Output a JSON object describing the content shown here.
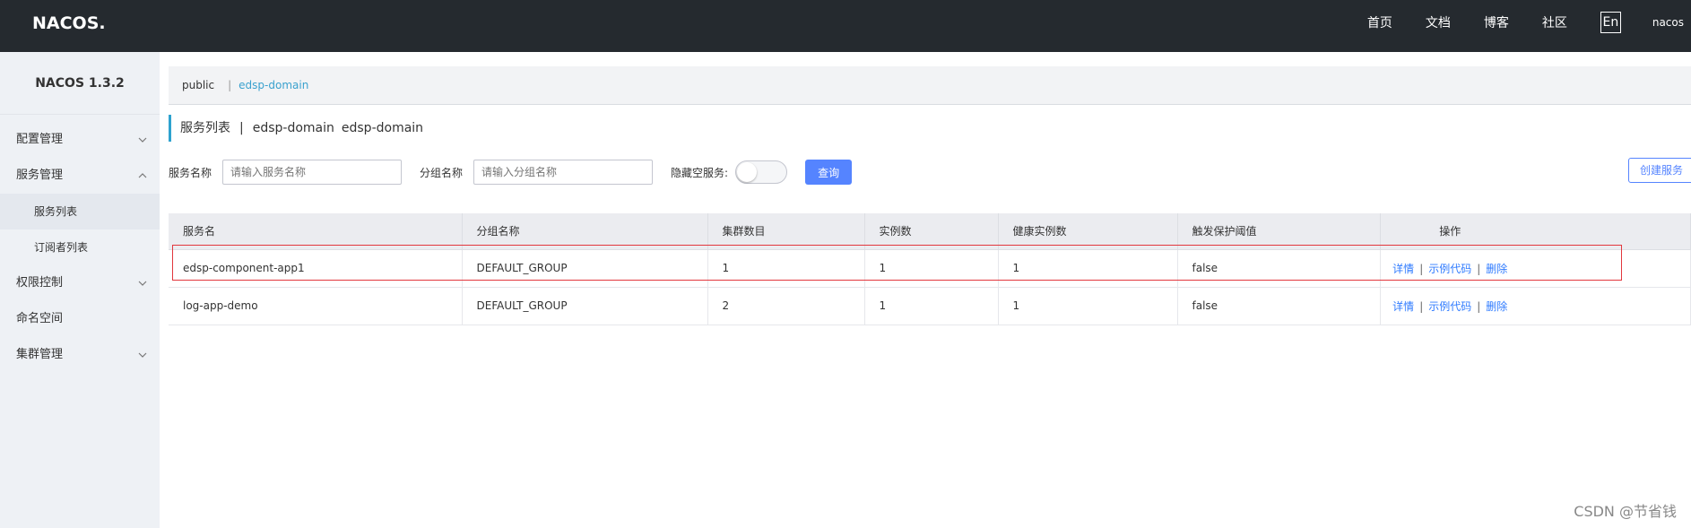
{
  "header": {
    "logo_text": "NACOS.",
    "nav": [
      "首页",
      "文档",
      "博客",
      "社区"
    ],
    "lang": "En",
    "user": "nacos"
  },
  "sidebar": {
    "title": "NACOS 1.3.2",
    "menu": {
      "config": "配置管理",
      "service": "服务管理",
      "service_list": "服务列表",
      "subscriber_list": "订阅者列表",
      "auth": "权限控制",
      "namespace": "命名空间",
      "cluster": "集群管理"
    }
  },
  "namespace_bar": {
    "items": [
      "public",
      "edsp-domain"
    ],
    "separator": "|"
  },
  "page_title": {
    "label": "服务列表",
    "separator": "|",
    "ns_name": "edsp-domain",
    "ns_id": "edsp-domain"
  },
  "filter": {
    "service_label": "服务名称",
    "service_placeholder": "请输入服务名称",
    "group_label": "分组名称",
    "group_placeholder": "请输入分组名称",
    "hide_empty_label": "隐藏空服务:",
    "query_label": "查询",
    "create_label": "创建服务"
  },
  "table": {
    "headers": [
      "服务名",
      "分组名称",
      "集群数目",
      "实例数",
      "健康实例数",
      "触发保护阈值",
      "操作"
    ],
    "rows": [
      [
        "edsp-component-app1",
        "DEFAULT_GROUP",
        "1",
        "1",
        "1",
        "false"
      ],
      [
        "log-app-demo",
        "DEFAULT_GROUP",
        "2",
        "1",
        "1",
        "false"
      ]
    ],
    "ops": {
      "detail": "详情",
      "sample_code": "示例代码",
      "delete": "删除",
      "separator": "|"
    }
  },
  "watermark": "CSDN @节省钱",
  "colors": {
    "topbar": "#252a2f",
    "accent_blue": "#5584ff",
    "link_blue": "#2f7bff",
    "highlight_red": "#e2373d"
  }
}
